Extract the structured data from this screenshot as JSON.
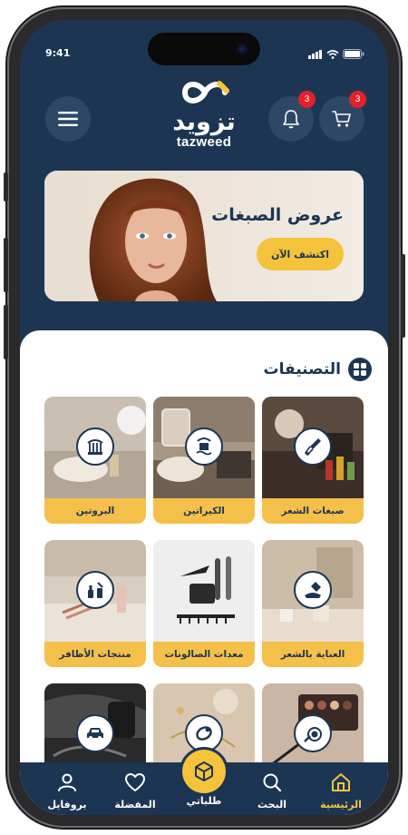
{
  "status_bar": {
    "time": "9:41"
  },
  "header": {
    "logo_ar": "تزويد",
    "logo_en": "tazweed",
    "notifications_count": "3",
    "cart_count": "3",
    "icons": {
      "menu": "hamburger-menu-icon",
      "notifications": "bell-icon",
      "cart": "cart-icon"
    }
  },
  "banner": {
    "title": "عروض الصبغات",
    "cta_label": "اكتشف الآن"
  },
  "categories": {
    "title": "التصنيفات",
    "items": [
      {
        "label": "صبغات الشعر",
        "icon": "hair-dye-brush-icon"
      },
      {
        "label": "الكيراتين",
        "icon": "keratin-hair-icon"
      },
      {
        "label": "البروتين",
        "icon": "protein-hair-icon"
      },
      {
        "label": "العناية بالشعر",
        "icon": "hair-care-icon"
      },
      {
        "label": "معدات الصالونات",
        "icon": "salon-equipment-icon"
      },
      {
        "label": "منتجات الأظافر",
        "icon": "nail-products-icon"
      },
      {
        "label": "",
        "icon": "makeup-icon"
      },
      {
        "label": "",
        "icon": "bracelet-icon"
      },
      {
        "label": "",
        "icon": "car-icon"
      }
    ]
  },
  "bottom_nav": {
    "items": [
      {
        "label": "الرئيسية",
        "icon": "home-icon",
        "active": true
      },
      {
        "label": "البحث",
        "icon": "search-icon"
      },
      {
        "label": "طلباتي",
        "icon": "box-icon"
      },
      {
        "label": "المفضلة",
        "icon": "heart-icon"
      },
      {
        "label": "بروفايل",
        "icon": "user-icon"
      }
    ]
  },
  "colors": {
    "navy": "#1c3553",
    "accent": "#f5c33b",
    "badge": "#e5202a"
  }
}
